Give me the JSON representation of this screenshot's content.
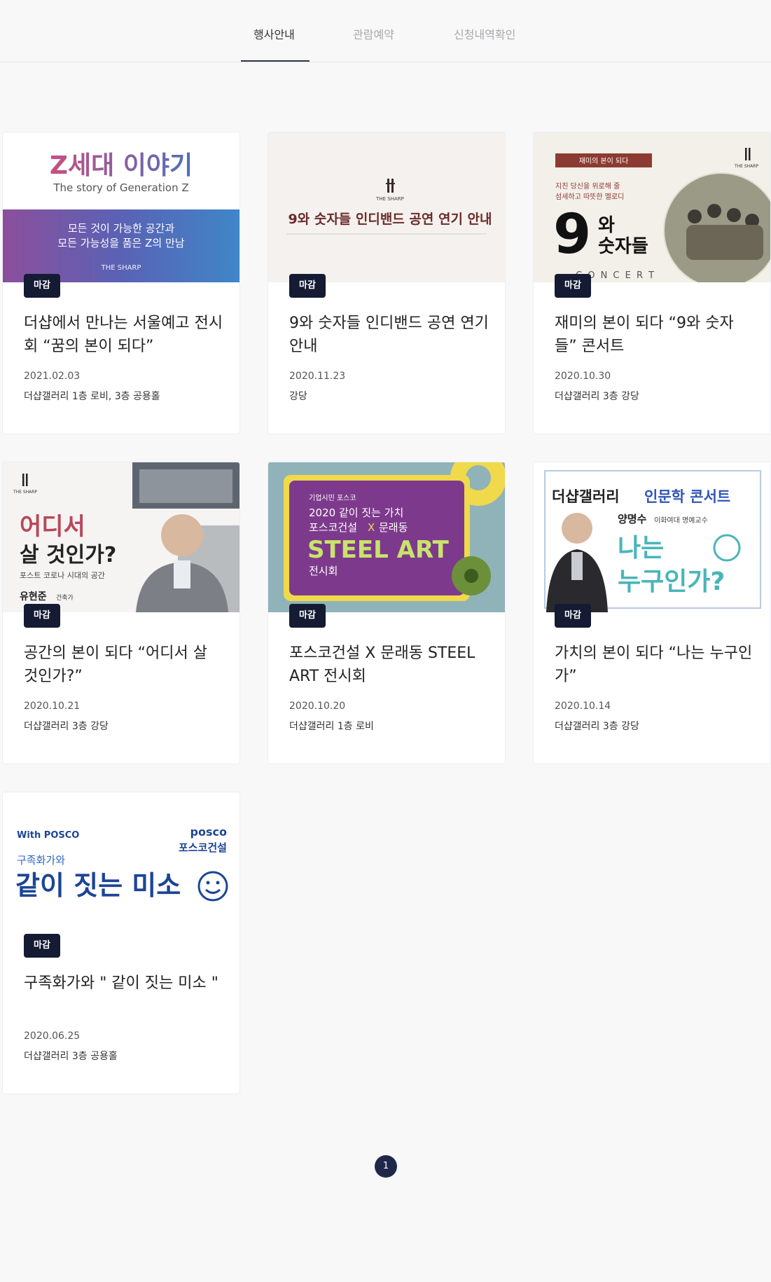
{
  "tabs": [
    {
      "label": "행사안내",
      "active": true
    },
    {
      "label": "관람예약",
      "active": false
    },
    {
      "label": "신청내역확인",
      "active": false
    }
  ],
  "cards": [
    {
      "badge": "마감",
      "title": "더샵에서 만나는 서울예고 전시회 “꿈의 본이 되다”",
      "date": "2021.02.03",
      "place": "더샵갤러리 1층 로비, 3층 공용홀",
      "thumb": {
        "headline": "Z세대 이야기",
        "sub": "The story of Generation Z",
        "line1": "모든 것이 가능한 공간과",
        "line2": "모든 가능성을 품은 Z의 만남",
        "brand": "THE SHARP"
      }
    },
    {
      "badge": "마감",
      "title": "9와 숫자들 인디밴드 공연 연기 안내",
      "date": "2020.11.23",
      "place": "강당",
      "thumb": {
        "brand": "THE SHARP",
        "notice": "9와 숫자들 인디밴드 공연 연기 안내"
      }
    },
    {
      "badge": "마감",
      "title": "재미의 본이 되다 “9와 숫자들” 콘서트",
      "date": "2020.10.30",
      "place": "더샵갤러리 3층 강당",
      "thumb": {
        "tag": "재미의 본이 되다",
        "brand": "THE SHARP",
        "copy1": "지친 당신을 위로해 줄",
        "copy2": "섬세하고 따뜻한 멜로디",
        "num": "9",
        "word1": "와",
        "word2": "숫자들",
        "concert": "C O N C E R T"
      }
    },
    {
      "badge": "마감",
      "title": "공간의 본이 되다 “어디서 살 것인가?”",
      "date": "2020.10.21",
      "place": "더샵갤러리 3층 강당",
      "thumb": {
        "brand": "THE SHARP",
        "line1": "어디서",
        "line2": "살 것인가?",
        "sub": "포스트 코로나 시대의 공간",
        "name": "유현준",
        "role": "건축가"
      }
    },
    {
      "badge": "마감",
      "title": "포스코건설 X 문래동 STEEL ART 전시회",
      "date": "2020.10.20",
      "place": "더샵갤러리 1층 로비",
      "thumb": {
        "small": "기업시민 포스코",
        "line1": "2020 같이 짓는 가치",
        "line2a": "포스코건설",
        "x": "X",
        "line2b": "문래동",
        "steel": "STEEL ART",
        "exhibit": "전시회"
      }
    },
    {
      "badge": "마감",
      "title": "가치의 본이 되다 “나는 누구인가”",
      "date": "2020.10.14",
      "place": "더샵갤러리 3층 강당",
      "thumb": {
        "head1": "더샵갤러리",
        "head2": "인문학 콘서트",
        "name": "양명수",
        "role": "이화여대 명예교수",
        "q1": "나는",
        "q2": "누구인가?"
      }
    },
    {
      "badge": "마감",
      "title": "구족화가와 \" 같이 짓는 미소 \"",
      "date": "2020.06.25",
      "place": "더샵갤러리 3층 공용홀",
      "thumb": {
        "with": "With POSCO",
        "posco": "posco",
        "posco_kr": "포스코건설",
        "sub": "구족화가와",
        "main": "같이 짓는 미소"
      }
    }
  ],
  "pagination": {
    "current": "1"
  },
  "colors": {
    "badge": "#141b33",
    "accent": "#20284a",
    "bg": "#f8f8f9"
  }
}
